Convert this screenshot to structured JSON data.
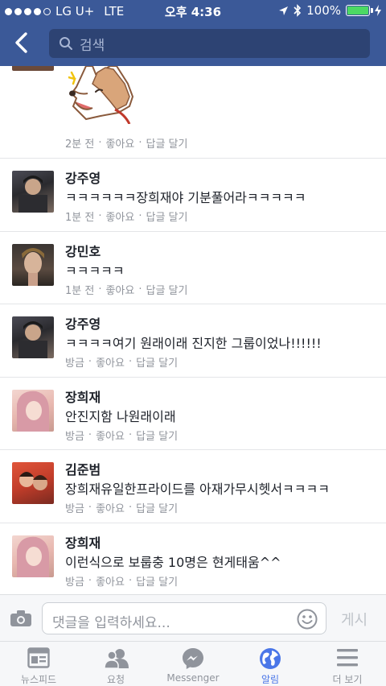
{
  "status_bar": {
    "carrier": "LG U+",
    "network": "LTE",
    "time": "오후 4:36",
    "battery": "100%"
  },
  "header": {
    "search_placeholder": "검색"
  },
  "comments": [
    {
      "name": "",
      "text": "",
      "time": "2분 전",
      "like": "좋아요",
      "reply": "답글 달기",
      "sticker": "dog-sticker"
    },
    {
      "name": "강주영",
      "text": "ㅋㅋㅋㅋㅋㅋ장희재야 기분풀어라ㅋㅋㅋㅋㅋ",
      "time": "1분 전",
      "like": "좋아요",
      "reply": "답글 달기"
    },
    {
      "name": "강민호",
      "text": "ㅋㅋㅋㅋㅋ",
      "time": "1분 전",
      "like": "좋아요",
      "reply": "답글 달기"
    },
    {
      "name": "강주영",
      "text": "ㅋㅋㅋㅋ여기 원래이래 진지한 그룹이었나!!!!!!",
      "time": "방금",
      "like": "좋아요",
      "reply": "답글 달기"
    },
    {
      "name": "장희재",
      "text": "안진지함 나원래이래",
      "time": "방금",
      "like": "좋아요",
      "reply": "답글 달기"
    },
    {
      "name": "김준범",
      "text": "장희재유일한프라이드를 아재가무시헷서ㅋㅋㅋㅋ",
      "time": "방금",
      "like": "좋아요",
      "reply": "답글 달기"
    },
    {
      "name": "장희재",
      "text": "이런식으로 보룹충 10명은 현게태움^^",
      "time": "방금",
      "like": "좋아요",
      "reply": "답글 달기"
    }
  ],
  "composer": {
    "placeholder": "댓글을 입력하세요...",
    "post_label": "게시"
  },
  "tabs": [
    {
      "label": "뉴스피드",
      "icon": "newsfeed-icon"
    },
    {
      "label": "요청",
      "icon": "friend-requests-icon"
    },
    {
      "label": "Messenger",
      "icon": "messenger-icon"
    },
    {
      "label": "알림",
      "icon": "globe-icon",
      "active": true
    },
    {
      "label": "더 보기",
      "icon": "menu-icon"
    }
  ],
  "colors": {
    "header": "#3b5998",
    "accent": "#4a76e8",
    "meta_text": "#90949c"
  }
}
